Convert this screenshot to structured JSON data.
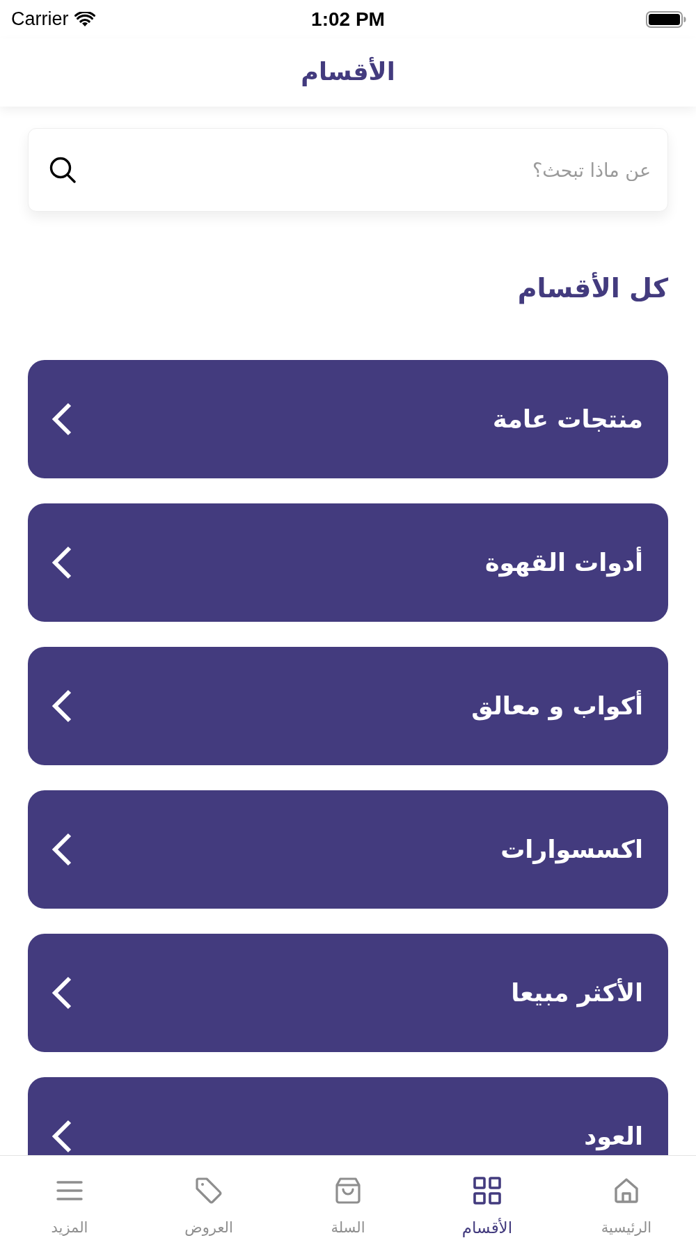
{
  "status_bar": {
    "carrier": "Carrier",
    "time": "1:02 PM"
  },
  "header": {
    "title": "الأقسام"
  },
  "search": {
    "placeholder": "عن ماذا تبحث؟"
  },
  "section": {
    "title": "كل الأقسام"
  },
  "categories": [
    {
      "label": "منتجات عامة"
    },
    {
      "label": "أدوات القهوة"
    },
    {
      "label": "أكواب و معالق"
    },
    {
      "label": "اكسسوارات"
    },
    {
      "label": "الأكثر مبيعا"
    },
    {
      "label": "العود"
    }
  ],
  "tab_bar": {
    "items": [
      {
        "label": "الرئيسية",
        "kind": "home",
        "selected": false
      },
      {
        "label": "الأقسام",
        "kind": "categories",
        "selected": true
      },
      {
        "label": "السلة",
        "kind": "cart",
        "selected": false
      },
      {
        "label": "العروض",
        "kind": "offers",
        "selected": false
      },
      {
        "label": "المزيد",
        "kind": "more",
        "selected": false
      }
    ]
  }
}
